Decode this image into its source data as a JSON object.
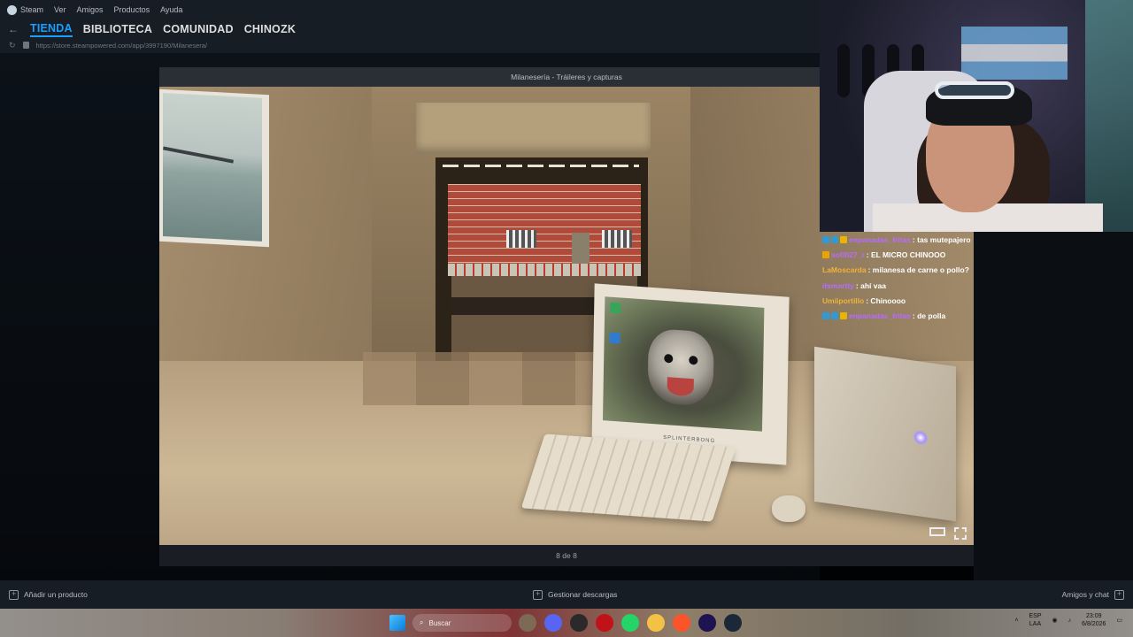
{
  "steam": {
    "menu": [
      "Steam",
      "Ver",
      "Amigos",
      "Productos",
      "Ayuda"
    ],
    "nav": {
      "back": "←",
      "forward": "→",
      "tabs": [
        "TIENDA",
        "BIBLIOTECA",
        "COMUNIDAD",
        "CHINOZK"
      ]
    },
    "url": "https://store.steampowered.com/app/3997190/Milanesera/"
  },
  "modal": {
    "title": "Milanesería - Tráileres y capturas",
    "counter": "8 de 8",
    "monitor_brand": "SPLINTERBONG"
  },
  "statusbar": {
    "add_product": "Añadir un producto",
    "downloads": "Gestionar descargas",
    "friends": "Amigos y chat"
  },
  "chat": [
    {
      "user": "enpanadas_fritas",
      "color": "#b86bff",
      "message": ": tas mutepajero",
      "badges": [
        "#2e9bd6",
        "#2e9bd6",
        "#e8b400"
      ]
    },
    {
      "user": "sofifi27_r",
      "color": "#b86bff",
      "message": ": EL MICRO CHINOOO",
      "badges": [
        "#e8a400"
      ]
    },
    {
      "user": "LaMoscarda",
      "color": "#f0b23a",
      "message": ": milanesa de carne o pollo?",
      "badges": []
    },
    {
      "user": "itsmartty",
      "color": "#b86bff",
      "message": ": ahí vaa",
      "badges": []
    },
    {
      "user": "Umiiportillo",
      "color": "#f0b23a",
      "message": ": Chinoooo",
      "badges": []
    },
    {
      "user": "enpanadas_fritas",
      "color": "#b86bff",
      "message": ": de polla",
      "badges": [
        "#2e9bd6",
        "#2e9bd6",
        "#e8b400"
      ]
    }
  ],
  "taskbar": {
    "search_placeholder": "Buscar",
    "apps": [
      {
        "name": "file-app-icon",
        "color": "#7c6a55"
      },
      {
        "name": "discord-icon",
        "color": "#5865f2"
      },
      {
        "name": "obs-icon",
        "color": "#2a2a2a"
      },
      {
        "name": "netflix-icon",
        "color": "#c11119"
      },
      {
        "name": "whatsapp-icon",
        "color": "#25d366"
      },
      {
        "name": "folder-icon",
        "color": "#f3c244"
      },
      {
        "name": "brave-icon",
        "color": "#fb542b"
      },
      {
        "name": "premiere-icon",
        "color": "#1e1351"
      },
      {
        "name": "steam-icon",
        "color": "#1b2838"
      }
    ],
    "lang": [
      "ESP",
      "LAA"
    ],
    "time": "23:09",
    "date": "6/8/2026"
  }
}
